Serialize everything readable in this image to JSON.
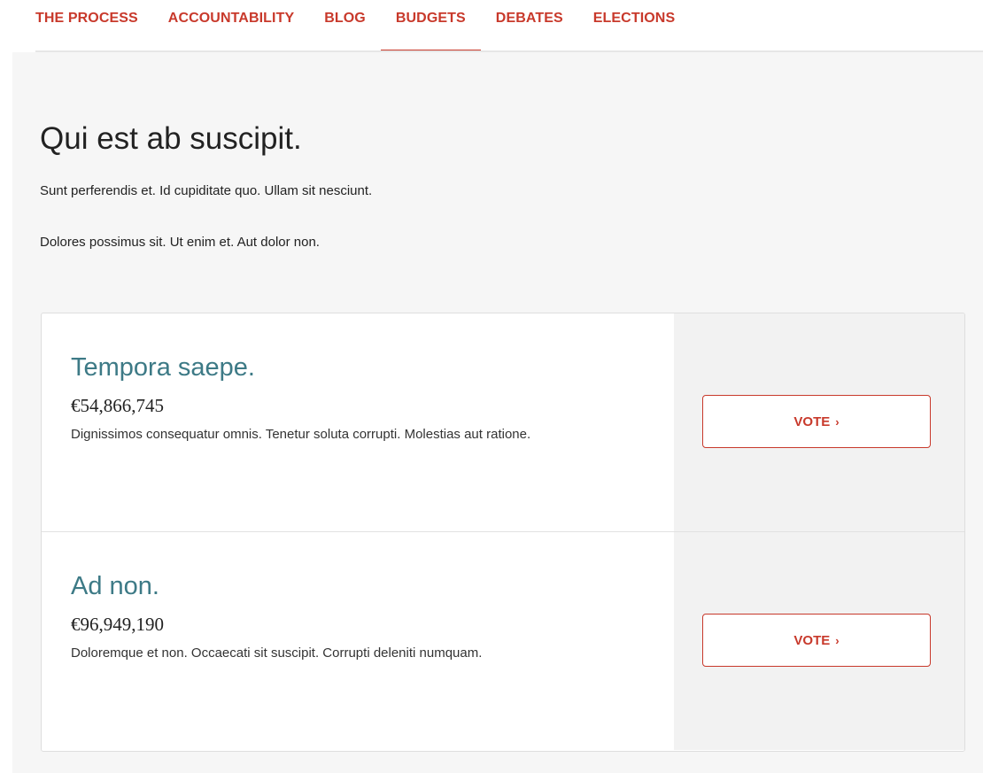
{
  "nav": {
    "items": [
      {
        "label": "THE PROCESS",
        "active": false
      },
      {
        "label": "ACCOUNTABILITY",
        "active": false
      },
      {
        "label": "BLOG",
        "active": false
      },
      {
        "label": "BUDGETS",
        "active": true
      },
      {
        "label": "DEBATES",
        "active": false
      },
      {
        "label": "ELECTIONS",
        "active": false
      }
    ],
    "accent_color": "#c8392b"
  },
  "page": {
    "title": "Qui est ab suscipit.",
    "intro": [
      "Sunt perferendis et. Id cupiditate quo. Ullam sit nesciunt.",
      "Dolores possimus sit. Ut enim et. Aut dolor non."
    ]
  },
  "budgets": [
    {
      "title": "Tempora saepe.",
      "amount": "€54,866,745",
      "description": "Dignissimos consequatur omnis. Tenetur soluta corrupti. Molestias aut ratione.",
      "vote_label": "VOTE",
      "vote_icon": "chevron-right-icon"
    },
    {
      "title": "Ad non.",
      "amount": "€96,949,190",
      "description": "Doloremque et non. Occaecati sit suscipit. Corrupti deleniti numquam.",
      "vote_label": "VOTE",
      "vote_icon": "chevron-right-icon"
    }
  ],
  "colors": {
    "title_teal": "#3d7a86",
    "background": "#f6f6f6"
  }
}
